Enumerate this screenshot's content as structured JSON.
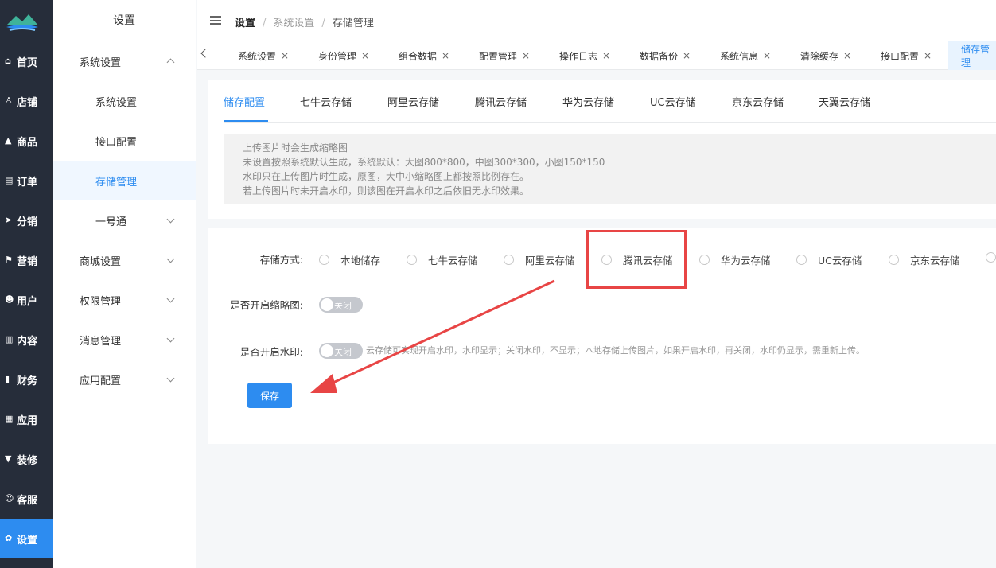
{
  "colors": {
    "accent": "#2d8cf0",
    "rail_bg": "#262d3a",
    "annotation": "#e84545"
  },
  "rail": [
    {
      "label": "首页",
      "icon": "home-icon"
    },
    {
      "label": "店铺",
      "icon": "store-icon"
    },
    {
      "label": "商品",
      "icon": "bag-icon"
    },
    {
      "label": "订单",
      "icon": "order-icon"
    },
    {
      "label": "分销",
      "icon": "send-icon"
    },
    {
      "label": "营销",
      "icon": "flag-icon"
    },
    {
      "label": "用户",
      "icon": "user-icon"
    },
    {
      "label": "内容",
      "icon": "book-icon"
    },
    {
      "label": "财务",
      "icon": "chart-icon"
    },
    {
      "label": "应用",
      "icon": "grid-icon"
    },
    {
      "label": "装修",
      "icon": "brush-icon"
    },
    {
      "label": "客服",
      "icon": "service-icon"
    },
    {
      "label": "设置",
      "icon": "gear-icon"
    }
  ],
  "sidebar": {
    "title": "设置",
    "items": [
      {
        "label": "系统设置"
      },
      {
        "label": "系统设置"
      },
      {
        "label": "接口配置"
      },
      {
        "label": "存储管理"
      },
      {
        "label": "一号通"
      },
      {
        "label": "商城设置"
      },
      {
        "label": "权限管理"
      },
      {
        "label": "消息管理"
      },
      {
        "label": "应用配置"
      }
    ]
  },
  "breadcrumb": {
    "b1": "设置",
    "b2": "系统设置",
    "b3": "存储管理",
    "sep": "/"
  },
  "tabs": [
    {
      "label": "系统设置",
      "close": "×"
    },
    {
      "label": "身份管理",
      "close": "×"
    },
    {
      "label": "组合数据",
      "close": "×"
    },
    {
      "label": "配置管理",
      "close": "×"
    },
    {
      "label": "操作日志",
      "close": "×"
    },
    {
      "label": "数据备份",
      "close": "×"
    },
    {
      "label": "系统信息",
      "close": "×"
    },
    {
      "label": "清除缓存",
      "close": "×"
    },
    {
      "label": "接口配置",
      "close": "×"
    },
    {
      "label": "储存管理"
    }
  ],
  "subtabs": [
    "储存配置",
    "七牛云存储",
    "阿里云存储",
    "腾讯云存储",
    "华为云存储",
    "UC云存储",
    "京东云存储",
    "天翼云存储"
  ],
  "notice": [
    "上传图片时会生成缩略图",
    "未设置按照系统默认生成，系统默认：大图800*800，中图300*300，小图150*150",
    "水印只在上传图片时生成，原图，大中小缩略图上都按照比例存在。",
    "若上传图片时未开启水印，则该图在开启水印之后依旧无水印效果。"
  ],
  "form": {
    "storage_label": "存储方式:",
    "storage_options": [
      "本地储存",
      "七牛云存储",
      "阿里云存储",
      "腾讯云存储",
      "华为云存储",
      "UC云存储",
      "京东云存储"
    ],
    "thumb_label": "是否开启缩略图:",
    "thumb_state": "关闭",
    "watermark_label": "是否开启水印:",
    "watermark_state": "关闭",
    "watermark_hint": "云存储可实现开启水印，水印显示；关闭水印，不显示；本地存储上传图片，如果开启水印，再关闭，水印仍显示，需重新上传。",
    "save_label": "保存"
  }
}
